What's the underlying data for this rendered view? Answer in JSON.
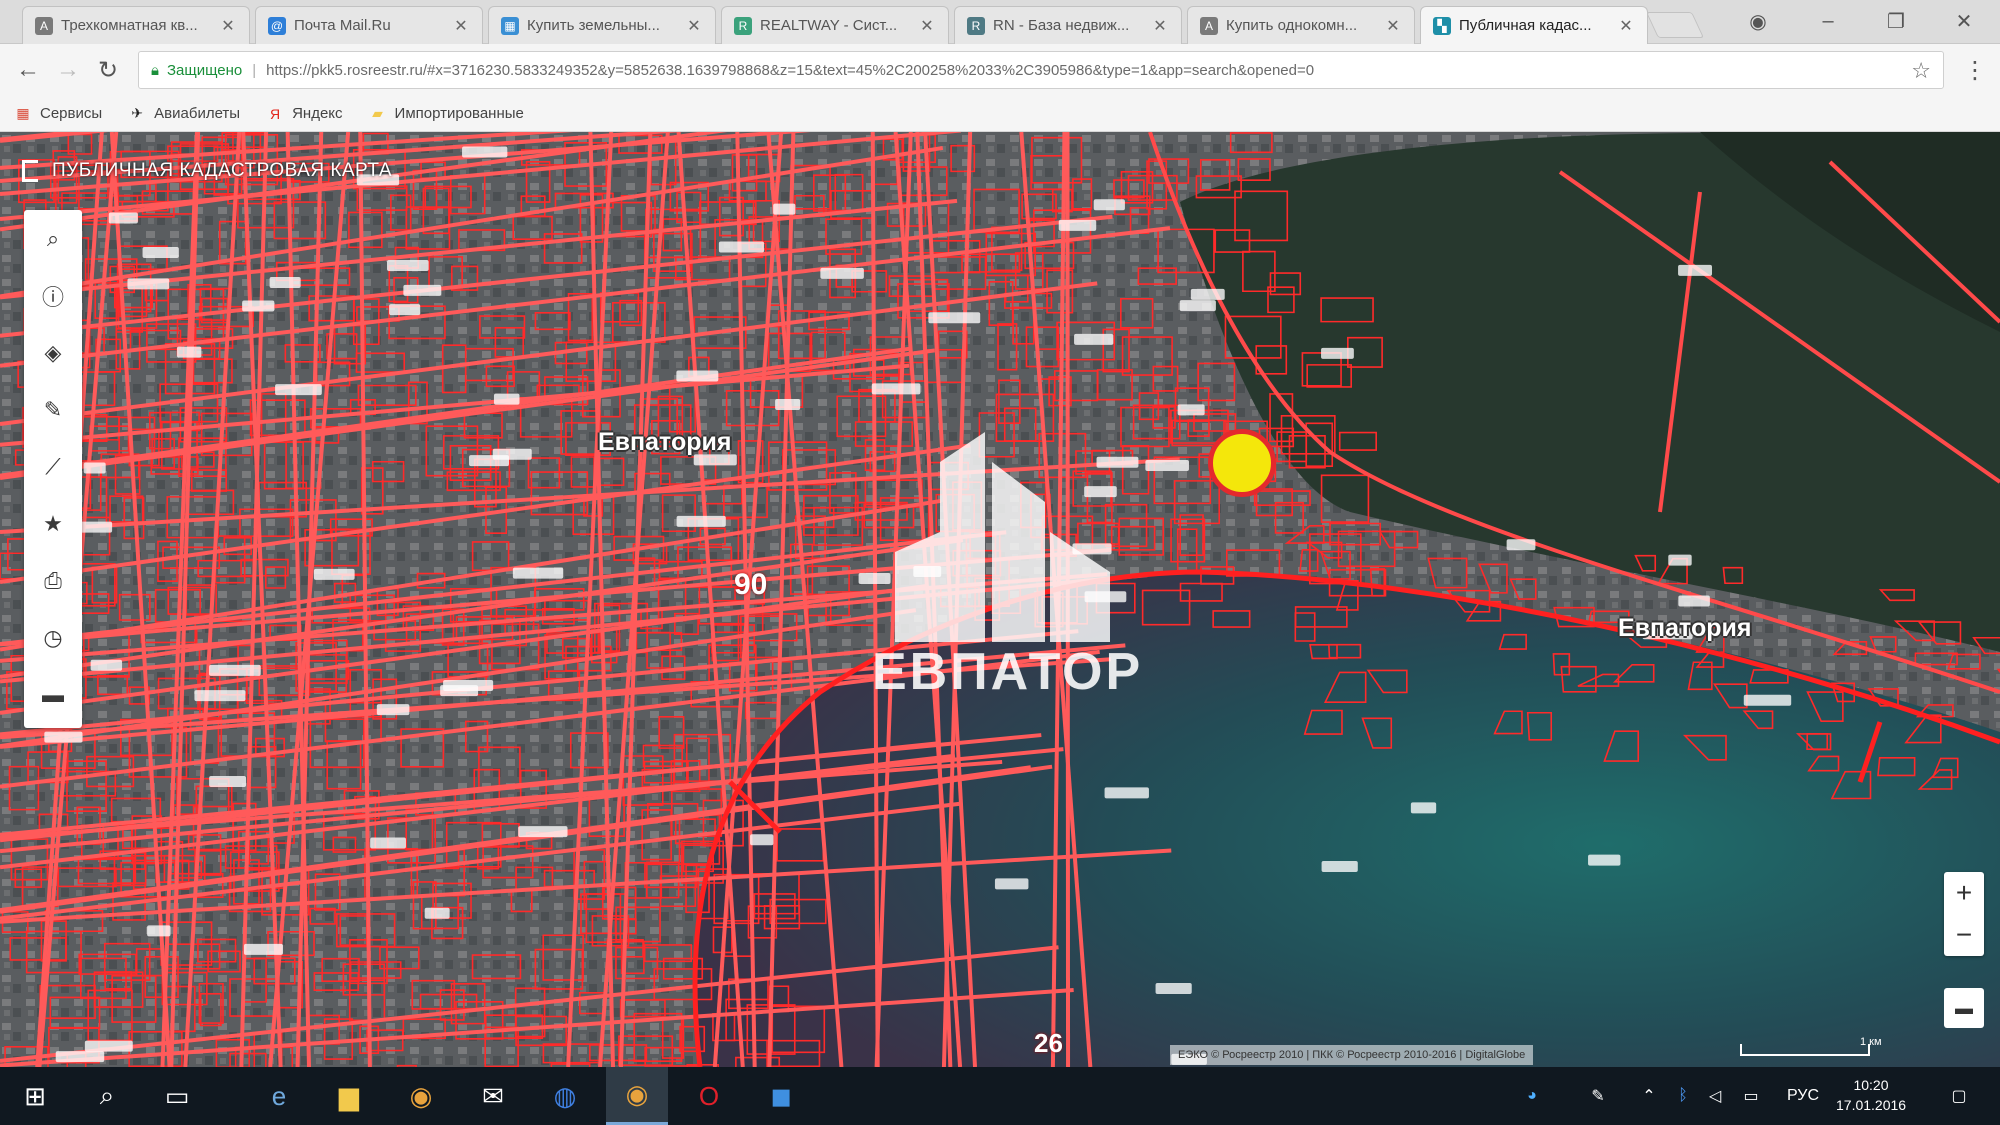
{
  "browser": {
    "tabs": [
      {
        "title": "Трехкомнатная кв...",
        "fav_color": "#7a7a7a",
        "fav_glyph": "A",
        "active": false
      },
      {
        "title": "Почта Mail.Ru",
        "fav_color": "#2e7fd8",
        "fav_glyph": "@",
        "active": false
      },
      {
        "title": "Купить земельны...",
        "fav_color": "#3a8fd4",
        "fav_glyph": "▦",
        "active": false
      },
      {
        "title": "REALTWAY - Сист...",
        "fav_color": "#3ba27c",
        "fav_glyph": "R",
        "active": false
      },
      {
        "title": "RN - База недвиж...",
        "fav_color": "#4f7a84",
        "fav_glyph": "R",
        "active": false
      },
      {
        "title": "Купить однокомн...",
        "fav_color": "#7a7a7a",
        "fav_glyph": "A",
        "active": false
      },
      {
        "title": "Публичная кадас...",
        "fav_color": "#1e8fa8",
        "fav_glyph": "▚",
        "active": true
      }
    ],
    "address": {
      "secure_label": "Защищено",
      "url": "https://pkk5.rosreestr.ru/#x=3716230.5833249352&y=5852638.1639798868&z=15&text=45%2C200258%2033%2C3905986&type=1&app=search&opened=0"
    },
    "bookmarks": [
      {
        "label": "Сервисы",
        "icon": "apps-icon",
        "color": "#d94a38"
      },
      {
        "label": "Авиабилеты",
        "icon": "plane-icon",
        "color": "#222"
      },
      {
        "label": "Яндекс",
        "icon": "yandex-icon",
        "color": "#e2231a"
      },
      {
        "label": "Импортированные",
        "icon": "folder-icon",
        "color": "#f2c94c"
      }
    ]
  },
  "map": {
    "title": "ПУБЛИЧНАЯ КАДАСТРОВАЯ КАРТА",
    "tools": [
      {
        "name": "search-icon",
        "glyph": "⌕"
      },
      {
        "name": "info-icon",
        "glyph": "ⓘ"
      },
      {
        "name": "layers-icon",
        "glyph": "◈"
      },
      {
        "name": "pencil-icon",
        "glyph": "✎"
      },
      {
        "name": "measure-icon",
        "glyph": "⟋"
      },
      {
        "name": "star-icon",
        "glyph": "★"
      },
      {
        "name": "print-icon",
        "glyph": "⎙"
      },
      {
        "name": "history-icon",
        "glyph": "◷"
      },
      {
        "name": "keyboard-icon",
        "glyph": "▬"
      }
    ],
    "city_labels": [
      {
        "text": "Евпатория",
        "id": "city-label-west"
      },
      {
        "text": "Евпатория",
        "id": "city-label-east"
      }
    ],
    "numbers": [
      {
        "text": "90",
        "id": "parcel-number-90"
      },
      {
        "text": "26",
        "id": "parcel-number-26"
      }
    ],
    "watermark": "ЕВПАТОР",
    "zoom_in": "+",
    "zoom_out": "−",
    "copyright": "ЕЭКО © Росреестр 2010 | ПКК © Росреестр 2010-2016 | DigitalGlobe",
    "scale": "1 км"
  },
  "taskbar": {
    "language": "РУС",
    "time": "10:20",
    "date": "17.01.2016"
  }
}
